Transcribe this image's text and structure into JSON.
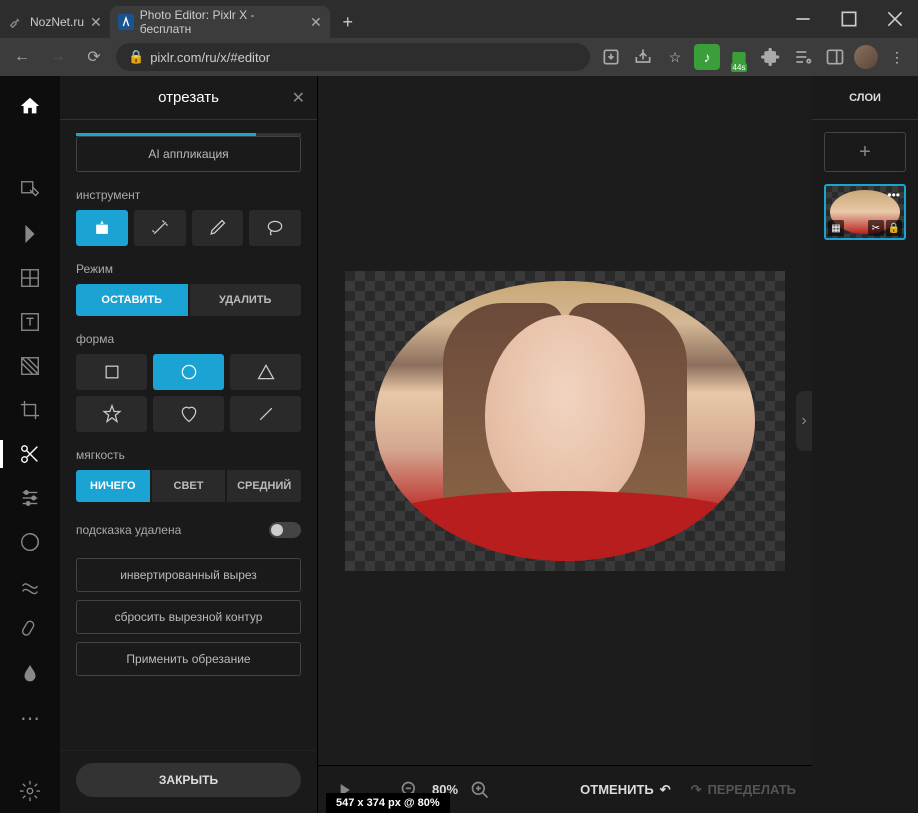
{
  "browser": {
    "tabs": [
      {
        "title": "NozNet.ru",
        "active": false
      },
      {
        "title": "Photo Editor: Pixlr X - бесплатн",
        "active": true
      }
    ],
    "url": "pixlr.com/ru/x/#editor",
    "badge_time": "44s"
  },
  "panel": {
    "title": "отрезать",
    "ai_app": "AI аппликация",
    "instrument_label": "инструмент",
    "mode_label": "Режим",
    "mode_keep": "ОСТАВИТЬ",
    "mode_remove": "УДАЛИТЬ",
    "shape_label": "форма",
    "softness_label": "мягкость",
    "softness_none": "НИЧЕГО",
    "softness_light": "СВЕТ",
    "softness_medium": "СРЕДНИЙ",
    "hint_removed": "подсказка удалена",
    "invert_cut": "инвертированный вырез",
    "reset_contour": "сбросить вырезной контур",
    "apply_crop": "Применить обрезание",
    "close": "ЗАКРЫТЬ"
  },
  "canvas": {
    "info": "547 x 374 px @ 80%"
  },
  "bottombar": {
    "zoom": "80%",
    "undo": "ОТМЕНИТЬ",
    "redo": "ПЕРЕДЕЛАТЬ"
  },
  "layers": {
    "title": "СЛОИ"
  }
}
